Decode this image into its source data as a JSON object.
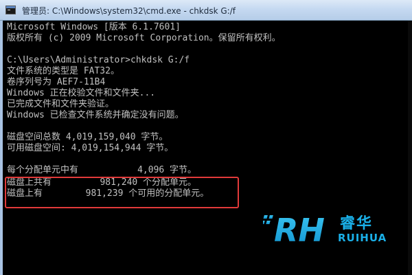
{
  "window": {
    "title": "管理员: C:\\Windows\\system32\\cmd.exe - chkdsk  G:/f"
  },
  "console": {
    "lines": [
      "Microsoft Windows [版本 6.1.7601]",
      "版权所有 (c) 2009 Microsoft Corporation。保留所有权利。",
      "",
      "C:\\Users\\Administrator>chkdsk G:/f",
      "文件系统的类型是 FAT32。",
      "卷序列号为 AEF7-11B4",
      "Windows 正在校验文件和文件夹...",
      "已完成文件和文件夹验证。",
      "Windows 已检查文件系统并确定没有问题。",
      "",
      "磁盘空间总数 4,019,159,040 字节。",
      "可用磁盘空间: 4,019,154,944 字节。",
      "",
      "每个分配单元中有           4,096 字节。",
      "磁盘上共有         981,240 个分配单元。",
      "磁盘上有        981,239 个可用的分配单元。"
    ]
  },
  "watermark": {
    "logo_text": "RH",
    "cn_text": "睿华",
    "en_text": "RUIHUA",
    "color": "#1ab0e8"
  },
  "colors": {
    "console_bg": "#000000",
    "console_text": "#c0c0c0",
    "highlight_border": "#e23a3a"
  }
}
